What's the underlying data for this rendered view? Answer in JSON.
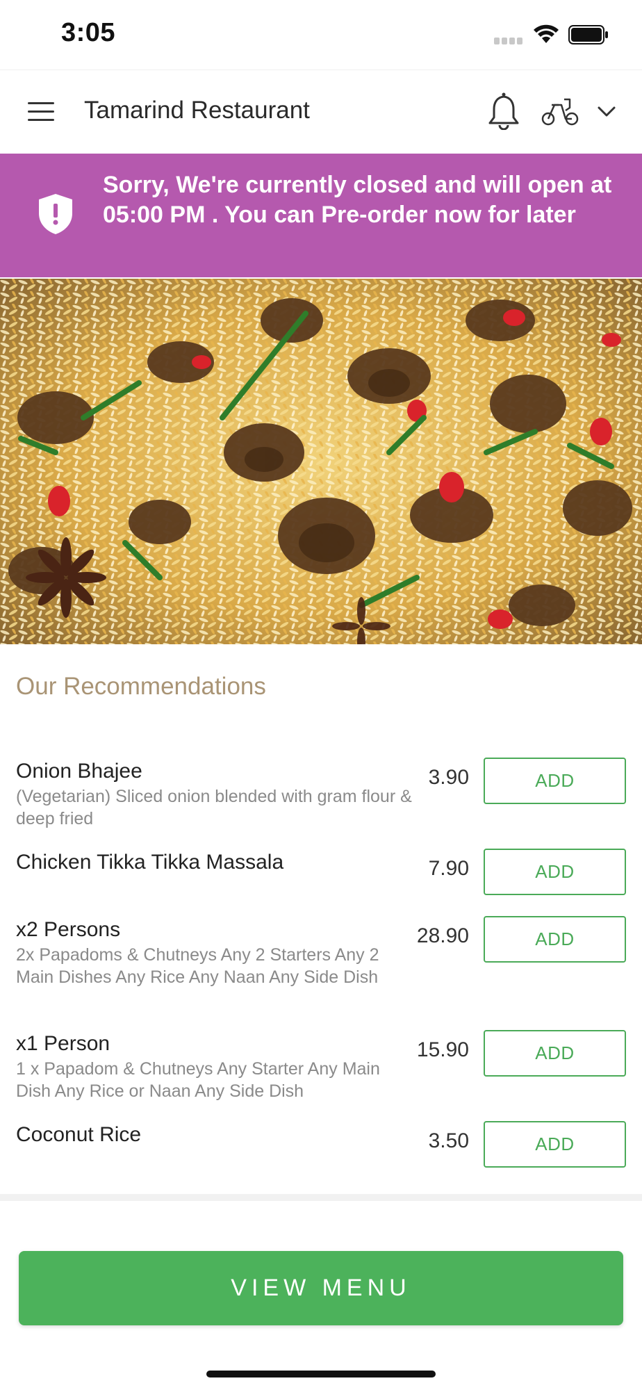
{
  "status_bar": {
    "time": "3:05"
  },
  "nav": {
    "title": "Tamarind Restaurant",
    "icons": [
      "hamburger-icon",
      "bell-icon",
      "delivery-icon",
      "chevron-down-icon"
    ]
  },
  "banner": {
    "text": "Sorry, We're currently closed and will open at 05:00 PM . You can Pre-order now for later",
    "icon": "shield-alert-icon",
    "color": "#b559ae"
  },
  "hero": {
    "subject": "biryani"
  },
  "recommendations": {
    "title": "Our Recommendations",
    "items": [
      {
        "name": "Onion Bhajee",
        "desc": "(Vegetarian) Sliced onion blended with gram flour & deep fried",
        "price": "3.90",
        "button": "ADD"
      },
      {
        "name": "Chicken Tikka Tikka Massala",
        "desc": "",
        "price": "7.90",
        "button": "ADD"
      },
      {
        "name": "x2 Persons",
        "desc": "2x Papadoms & Chutneys  Any 2 Starters  Any 2 Main Dishes  Any Rice  Any Naan  Any Side Dish",
        "price": "28.90",
        "button": "ADD"
      },
      {
        "name": "x1 Person",
        "desc": "1 x Papadom & Chutneys  Any Starter  Any Main Dish  Any Rice or Naan  Any Side Dish",
        "price": "15.90",
        "button": "ADD"
      },
      {
        "name": "Coconut Rice",
        "desc": "",
        "price": "3.50",
        "button": "ADD"
      }
    ]
  },
  "view_menu": {
    "label": "VIEW MENU",
    "color": "#4cb25b"
  },
  "colors": {
    "accent_green": "#4aaa58",
    "heading_gold": "#a99475"
  }
}
